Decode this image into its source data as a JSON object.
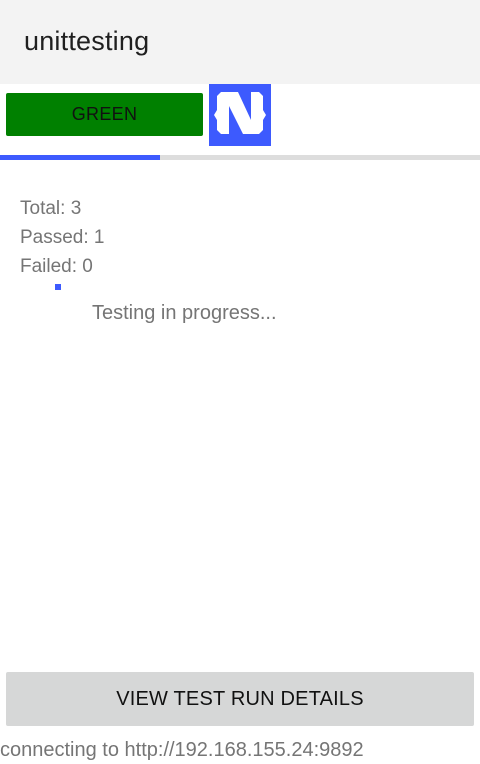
{
  "app": {
    "title": "unittesting"
  },
  "status_button": {
    "label": "GREEN",
    "color": "#008000"
  },
  "logo": {
    "icon": "nativescript-logo-icon",
    "color": "#3d5afe"
  },
  "progress": {
    "fraction": 0.333,
    "fill_color": "#3d5afe",
    "track_color": "#dddddd"
  },
  "stats": {
    "total": "Total: 3",
    "passed": "Passed: 1",
    "failed": "Failed: 0"
  },
  "status_text": "Testing in progress...",
  "details_button": {
    "label": "VIEW TEST RUN DETAILS"
  },
  "connection": {
    "text": "connecting to http://192.168.155.24:9892"
  }
}
